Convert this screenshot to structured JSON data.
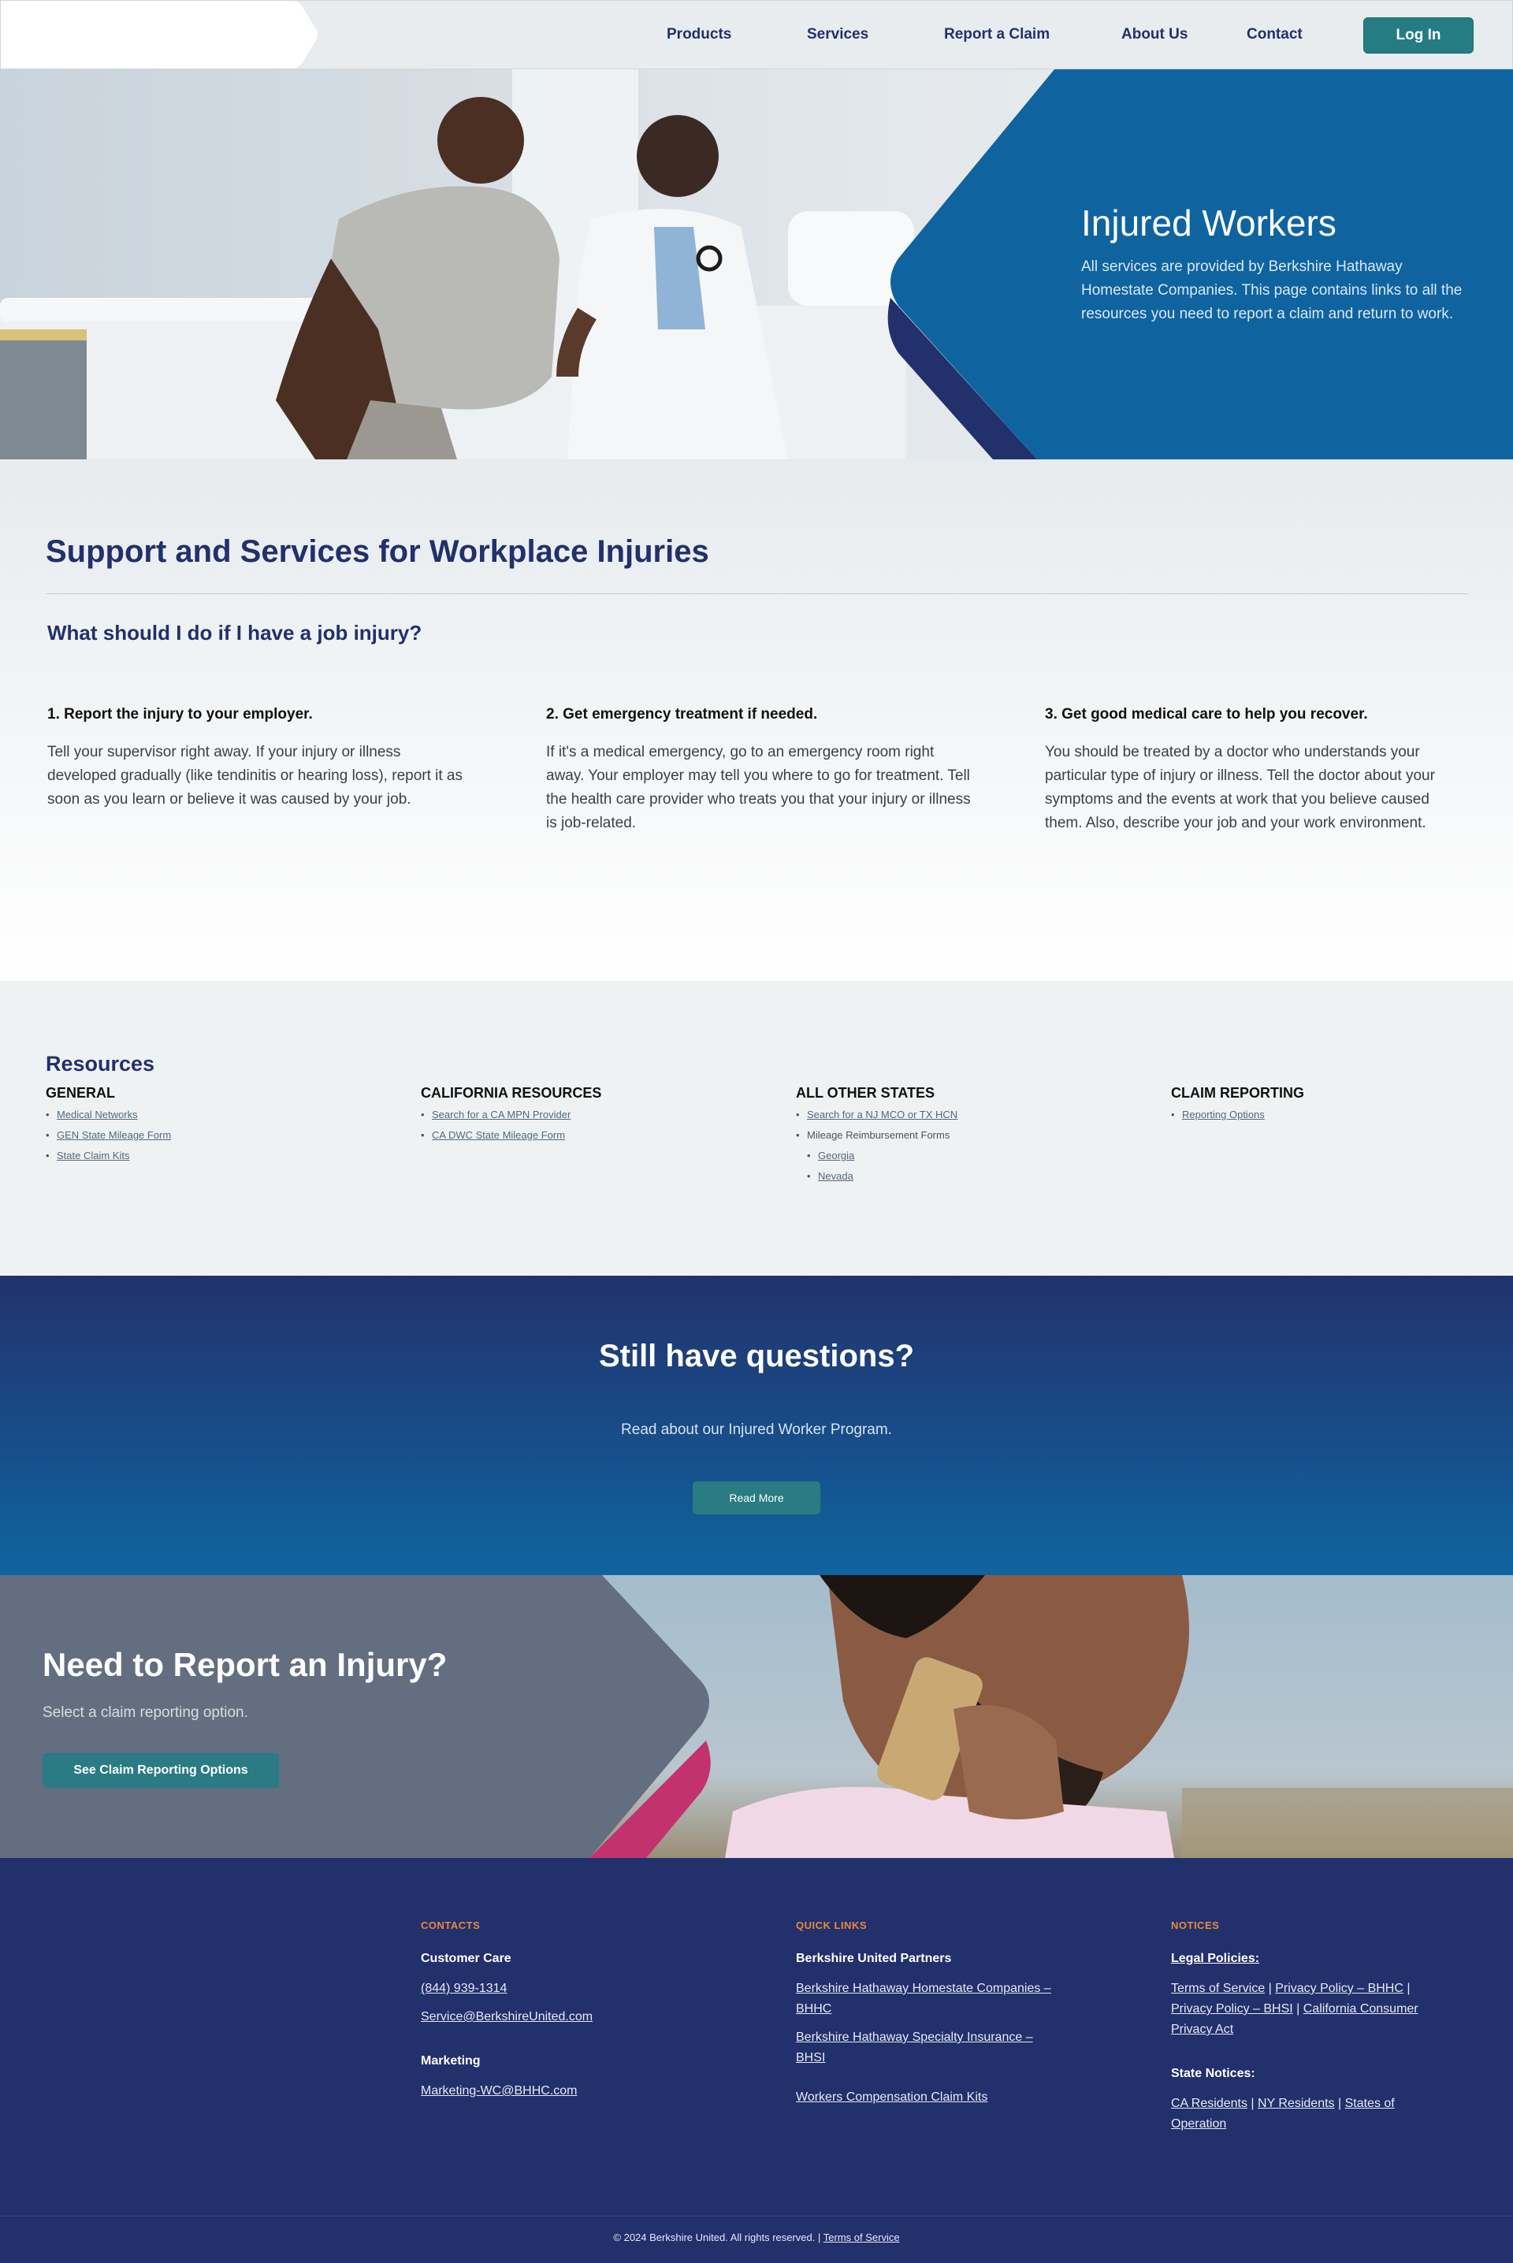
{
  "header": {
    "nav": [
      "Products",
      "Services",
      "Report a Claim",
      "About Us",
      "Contact"
    ],
    "login_label": "Log In"
  },
  "hero": {
    "title": "Injured Workers",
    "text": "All services are provided by Berkshire Hathaway Homestate Companies. This page contains links to all the resources you need to report a claim and return to work."
  },
  "support": {
    "title": "Support and Services for Workplace Injuries",
    "subtitle": "What should I do if I have a job injury?",
    "steps": [
      {
        "title": "1. Report the injury to your employer.",
        "text": "Tell your supervisor right away. If your injury or illness developed gradually (like tendinitis or hearing loss), report it as soon as you learn or believe it was caused by your job."
      },
      {
        "title": "2. Get emergency treatment if needed.",
        "text": "If it's a medical emergency, go to an emergency room right away. Your employer may tell you where to go for treatment. Tell the health care provider who treats you that your injury or illness is job-related."
      },
      {
        "title": "3. Get good medical care to help you recover.",
        "text": "You should be treated by a doctor who understands your particular type of injury or illness. Tell the doctor about your symptoms and the events at work that you believe caused them. Also, describe your job and your work environment."
      }
    ]
  },
  "resources": {
    "title": "Resources",
    "columns": [
      {
        "heading": "GENERAL",
        "items": [
          "Medical Networks",
          "GEN State Mileage Form",
          "State Claim Kits"
        ]
      },
      {
        "heading": "CALIFORNIA RESOURCES",
        "items": [
          "Search for a CA MPN Provider",
          "CA DWC State Mileage Form"
        ]
      },
      {
        "heading": "ALL OTHER STATES",
        "items": [
          "Search for a NJ MCO or TX HCN",
          "Mileage Reimbursement Forms",
          "Georgia",
          "Nevada"
        ]
      },
      {
        "heading": "CLAIM REPORTING",
        "items": [
          "Reporting Options"
        ]
      }
    ]
  },
  "questions": {
    "title": "Still have questions?",
    "text": "Read about our Injured Worker Program.",
    "button": "Read More"
  },
  "report": {
    "title": "Need to Report an Injury?",
    "text": "Select a claim reporting option.",
    "button": "See Claim Reporting Options"
  },
  "footer": {
    "contacts": {
      "heading": "CONTACTS",
      "care_label": "Customer Care",
      "phone": "(844) 939-1314",
      "email": "Service@BerkshireUnited.com",
      "marketing_label": "Marketing",
      "marketing_email": "Marketing-WC@BHHC.com"
    },
    "quick_links": {
      "heading": "QUICK LINKS",
      "partners_label": "Berkshire United Partners",
      "link1": "Berkshire Hathaway Homestate Companies – BHHC",
      "link2": "Berkshire Hathaway Specialty Insurance – BHSI",
      "link3": "Workers Compensation Claim Kits"
    },
    "notices": {
      "heading": "NOTICES",
      "legal_label": "Legal Policies:",
      "legal_links": [
        "Terms of Service",
        "Privacy Policy – BHHC",
        "Privacy Policy – BHSI",
        "California Consumer Privacy Act"
      ],
      "state_label": "State Notices:",
      "state_links": [
        "CA Residents",
        "NY Residents",
        "States of Operation"
      ],
      "separator": "|"
    },
    "copyright": "© 2024 Berkshire United. All rights reserved. |",
    "copyright_link": "Terms of Service"
  },
  "colors": {
    "navy": "#22306b",
    "blue": "#0f64a0",
    "teal": "#257c83",
    "orange": "#e8893f",
    "magenta": "#c2336e"
  }
}
